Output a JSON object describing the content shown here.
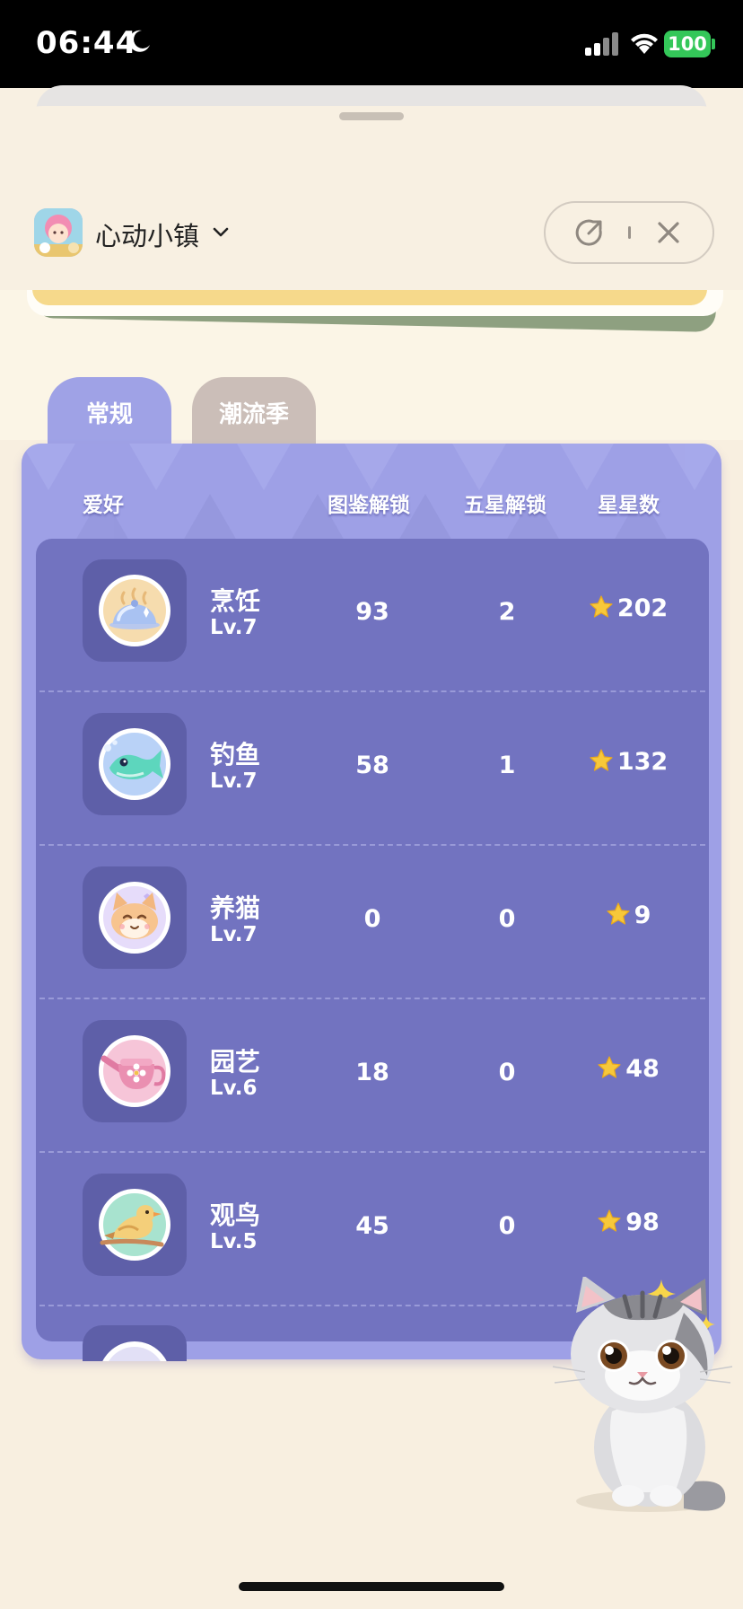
{
  "status_bar": {
    "time": "06:44",
    "battery": "100"
  },
  "miniapp": {
    "name": "心动小镇"
  },
  "tabs": [
    {
      "label": "常规",
      "active": true
    },
    {
      "label": "潮流季",
      "active": false
    }
  ],
  "table": {
    "columns": {
      "hobby": "爱好",
      "codex_unlock": "图鉴解锁",
      "five_star_unlock": "五星解锁",
      "star_count": "星星数"
    },
    "rows": [
      {
        "name": "烹饪",
        "level": "Lv.7",
        "codex": "93",
        "five_star": "2",
        "stars": "202",
        "icon": "cooking-icon"
      },
      {
        "name": "钓鱼",
        "level": "Lv.7",
        "codex": "58",
        "five_star": "1",
        "stars": "132",
        "icon": "fishing-icon"
      },
      {
        "name": "养猫",
        "level": "Lv.7",
        "codex": "0",
        "five_star": "0",
        "stars": "9",
        "icon": "cat-raising-icon"
      },
      {
        "name": "园艺",
        "level": "Lv.6",
        "codex": "18",
        "five_star": "0",
        "stars": "48",
        "icon": "gardening-icon"
      },
      {
        "name": "观鸟",
        "level": "Lv.5",
        "codex": "45",
        "five_star": "0",
        "stars": "98",
        "icon": "birdwatching-icon"
      }
    ]
  },
  "colors": {
    "panel": "#9ea0e6",
    "inner": "#7273c0",
    "tile": "#5e5fa8",
    "tab_active": "#9fa2e6",
    "tab_inactive": "#cbbeb8",
    "background": "#f8f0e2"
  }
}
